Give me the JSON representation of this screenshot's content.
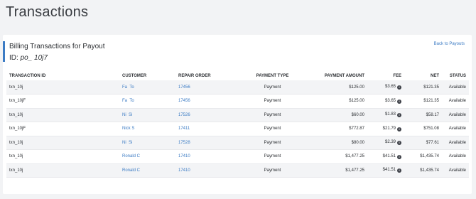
{
  "page": {
    "title": "Transactions"
  },
  "card": {
    "title": "Billing Transactions for Payout",
    "id_label": "ID:",
    "id_value": "po_ 10j7",
    "back_link": "Back to Payouts"
  },
  "table": {
    "columns": [
      "TRANSACTION ID",
      "CUSTOMER",
      "REPAIR ORDER",
      "PAYMENT TYPE",
      "PAYMENT AMOUNT",
      "FEE",
      "NET",
      "STATUS"
    ],
    "rows": [
      {
        "txn": "txn_10j",
        "customer": "Fa",
        "customer2": "To",
        "repair_order": "17456",
        "payment_type": "Payment",
        "amount": "$125.00",
        "fee": "$3.65",
        "net": "$121.35",
        "status": "Available"
      },
      {
        "txn": "txn_10jF",
        "customer": "Fa",
        "customer2": "To",
        "repair_order": "17456",
        "payment_type": "Payment",
        "amount": "$125.00",
        "fee": "$3.65",
        "net": "$121.35",
        "status": "Available"
      },
      {
        "txn": "txn_10j",
        "customer": "Ni",
        "customer2": "Si",
        "repair_order": "17526",
        "payment_type": "Payment",
        "amount": "$60.00",
        "fee": "$1.83",
        "net": "$58.17",
        "status": "Available"
      },
      {
        "txn": "txn_10jF",
        "customer": "Nick S",
        "customer2": "",
        "repair_order": "17411",
        "payment_type": "Payment",
        "amount": "$772.87",
        "fee": "$21.79",
        "net": "$751.08",
        "status": "Available"
      },
      {
        "txn": "txn_10j",
        "customer": "Ni",
        "customer2": "Si",
        "repair_order": "17528",
        "payment_type": "Payment",
        "amount": "$80.00",
        "fee": "$2.39",
        "net": "$77.61",
        "status": "Available"
      },
      {
        "txn": "txn_10j",
        "customer": "Ronald C",
        "customer2": "",
        "repair_order": "17410",
        "payment_type": "Payment",
        "amount": "$1,477.25",
        "fee": "$41.51",
        "net": "$1,435.74",
        "status": "Available"
      },
      {
        "txn": "txn_10j",
        "customer": "Ronald C",
        "customer2": "",
        "repair_order": "17410",
        "payment_type": "Payment",
        "amount": "$1,477.25",
        "fee": "$41.51",
        "net": "$1,435.74",
        "status": "Available"
      }
    ]
  },
  "icons": {
    "fee_info": "info-icon"
  },
  "colors": {
    "accent": "#3b7bc4",
    "background": "#f2f3f5"
  }
}
